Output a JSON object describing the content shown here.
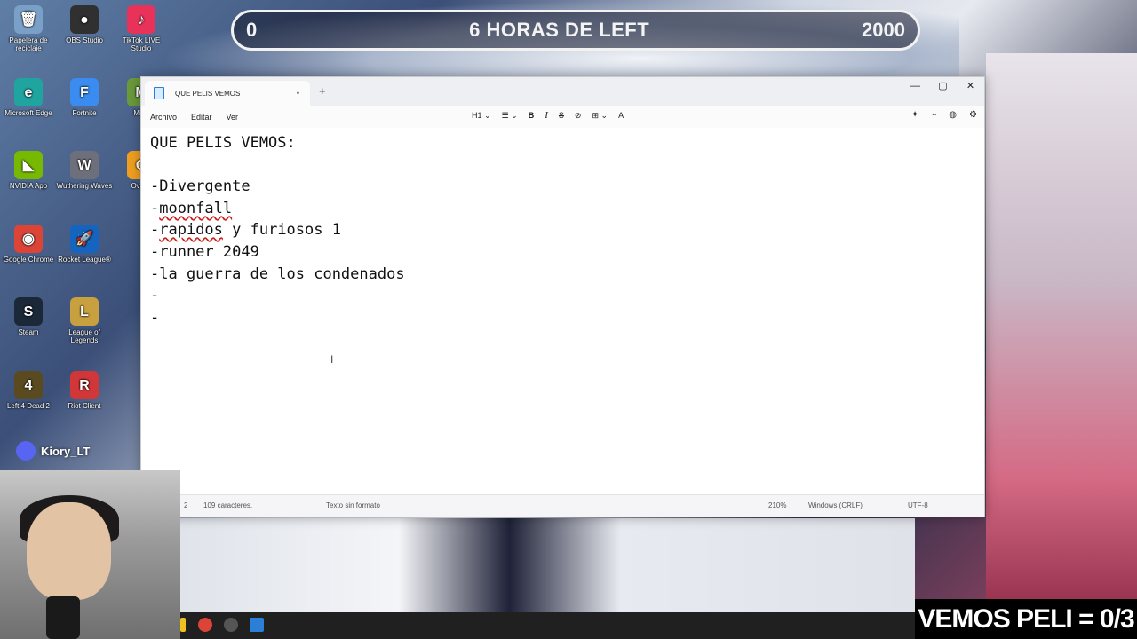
{
  "desktop": {
    "icons": [
      {
        "label": "Papelera de reciclaje",
        "icon": "recycle-bin-icon",
        "color": "#7aa0c8",
        "glyph": "🗑"
      },
      {
        "label": "OBS Studio",
        "icon": "obs-icon",
        "color": "#303030",
        "glyph": "●"
      },
      {
        "label": "TikTok LIVE Studio",
        "icon": "tiktok-icon",
        "color": "#e8325a",
        "glyph": "♪"
      },
      {
        "label": "Microsoft Edge",
        "icon": "edge-icon",
        "color": "#1fa4a0",
        "glyph": "e"
      },
      {
        "label": "Fortnite",
        "icon": "fortnite-icon",
        "color": "#3a8cf0",
        "glyph": "F"
      },
      {
        "label": "Mine",
        "icon": "minecraft-icon",
        "color": "#6a9a3a",
        "glyph": "M"
      },
      {
        "label": "NVIDIA App",
        "icon": "nvidia-icon",
        "color": "#76b900",
        "glyph": "◣"
      },
      {
        "label": "Wuthering Waves",
        "icon": "wuthering-waves-icon",
        "color": "#6d6f7a",
        "glyph": "W"
      },
      {
        "label": "Overw",
        "icon": "overwatch-icon",
        "color": "#f0a020",
        "glyph": "O"
      },
      {
        "label": "Google Chrome",
        "icon": "chrome-icon",
        "color": "#db4437",
        "glyph": "◉"
      },
      {
        "label": "Rocket League®",
        "icon": "rocket-league-icon",
        "color": "#1565c0",
        "glyph": "🚀"
      },
      {
        "label": "Steam",
        "icon": "steam-icon",
        "color": "#1b2838",
        "glyph": "S"
      },
      {
        "label": "League of Legends",
        "icon": "league-icon",
        "color": "#c8a040",
        "glyph": "L"
      },
      {
        "label": "Left 4 Dead 2",
        "icon": "left4dead-icon",
        "color": "#5a4a20",
        "glyph": "4"
      },
      {
        "label": "Riot Client",
        "icon": "riot-client-icon",
        "color": "#d13639",
        "glyph": "R"
      }
    ]
  },
  "stream_bar": {
    "left": "0",
    "center": "6 HORAS DE LEFT",
    "right": "2000"
  },
  "notepad": {
    "tab_title": "QUE PELIS VEMOS",
    "tab_close": "•",
    "new_tab": "+",
    "controls": {
      "minimize": "—",
      "maximize": "▢",
      "close": "✕"
    },
    "menu": [
      "Archivo",
      "Editar",
      "Ver"
    ],
    "toolbar": {
      "heading": "H1",
      "heading_caret": "⌄",
      "list": "☰",
      "list_caret": "⌄",
      "bold": "B",
      "italic": "I",
      "strike": "S",
      "link": "⊘",
      "table": "⊞",
      "table_caret": "⌄",
      "clear": "A"
    },
    "lines": {
      "l1": "QUE PELIS VEMOS:",
      "l3": "-Divergente",
      "l4_dash": "-",
      "l4_word": "moonfall",
      "l5_dash": "-",
      "l5_word": "rapidos",
      "l5_rest": " y furiosos 1",
      "l6": "-runner 2049",
      "l7": "-la guerra de los condenados",
      "l8": "-",
      "l9": "-"
    },
    "status": {
      "line": "2",
      "chars": "109 caracteres.",
      "format": "Texto sin formato",
      "zoom": "210%",
      "eol": "Windows (CRLF)",
      "encoding": "UTF-8"
    }
  },
  "overlay": {
    "discord_name": "Kiory_LT",
    "counter": "VEMOS PELI = 0/3"
  }
}
